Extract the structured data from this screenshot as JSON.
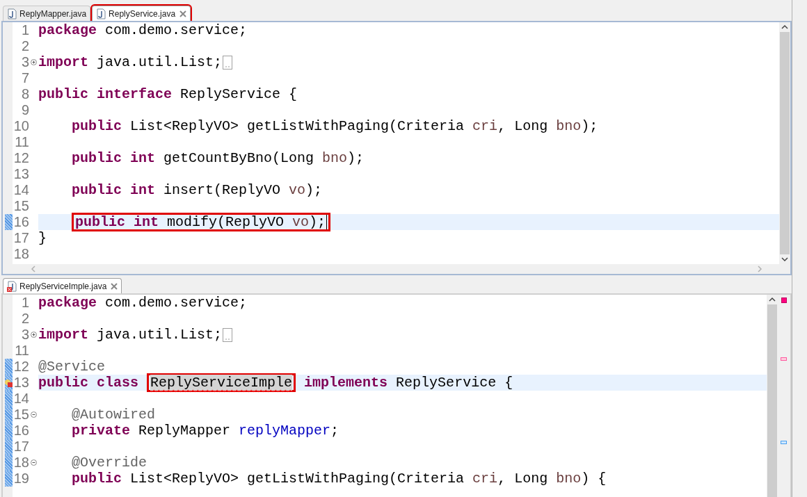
{
  "editors": [
    {
      "active": true,
      "tabs": [
        {
          "label": "ReplyMapper.java",
          "selected": false,
          "boxed": false,
          "error": false,
          "closable": false
        },
        {
          "label": "ReplyService.java",
          "selected": true,
          "boxed": true,
          "error": false,
          "closable": true
        }
      ],
      "lines": [
        {
          "number": "1",
          "segments": [
            {
              "kind": "kw",
              "text": "package"
            },
            {
              "kind": "plain",
              "text": " com.demo.service;"
            }
          ]
        },
        {
          "number": "2"
        },
        {
          "number": "3",
          "fold": {
            "collapsed": true
          },
          "folded": true,
          "segments": [
            {
              "kind": "kw",
              "text": "import"
            },
            {
              "kind": "plain",
              "text": " java.util.List;"
            }
          ]
        },
        {
          "number": "7"
        },
        {
          "number": "8",
          "segments": [
            {
              "kind": "kw",
              "text": "public"
            },
            {
              "kind": "kw",
              "text": " interface"
            },
            {
              "kind": "plain",
              "text": " ReplyService {"
            }
          ]
        },
        {
          "number": "9"
        },
        {
          "number": "10",
          "indented": true,
          "segments": [
            {
              "kind": "kw",
              "text": "public"
            },
            {
              "kind": "plain",
              "text": " List<ReplyVO> getListWithPaging(Criteria"
            },
            {
              "kind": "param",
              "text": " cri"
            },
            {
              "kind": "plain",
              "text": ", Long"
            },
            {
              "kind": "param",
              "text": " bno"
            },
            {
              "kind": "plain",
              "text": ");"
            }
          ]
        },
        {
          "number": "11"
        },
        {
          "number": "12",
          "indented": true,
          "segments": [
            {
              "kind": "kw",
              "text": "public"
            },
            {
              "kind": "kw",
              "text": " int"
            },
            {
              "kind": "plain",
              "text": " getCountByBno(Long"
            },
            {
              "kind": "param",
              "text": " bno"
            },
            {
              "kind": "plain",
              "text": ");"
            }
          ]
        },
        {
          "number": "13"
        },
        {
          "number": "14",
          "indented": true,
          "segments": [
            {
              "kind": "kw",
              "text": "public"
            },
            {
              "kind": "kw",
              "text": " int"
            },
            {
              "kind": "plain",
              "text": " insert(ReplyVO"
            },
            {
              "kind": "param",
              "text": " vo"
            },
            {
              "kind": "plain",
              "text": ");"
            }
          ]
        },
        {
          "number": "15"
        },
        {
          "number": "16",
          "indented": true,
          "current": true,
          "changed": true,
          "caret": true,
          "boxed": true,
          "segments": [
            {
              "kind": "kw",
              "text": "public"
            },
            {
              "kind": "kw",
              "text": " int"
            },
            {
              "kind": "plain",
              "text": " modify(ReplyVO"
            },
            {
              "kind": "param",
              "text": " vo"
            },
            {
              "kind": "plain",
              "text": ");"
            }
          ]
        },
        {
          "number": "17",
          "segments": [
            {
              "kind": "plain",
              "text": "}"
            }
          ]
        },
        {
          "number": "18"
        }
      ]
    },
    {
      "active": false,
      "tabs": [
        {
          "label": "ReplyServiceImple.java",
          "selected": true,
          "boxed": false,
          "error": true,
          "closable": true
        }
      ],
      "lines": [
        {
          "number": "1",
          "segments": [
            {
              "kind": "kw",
              "text": "package"
            },
            {
              "kind": "plain",
              "text": " com.demo.service;"
            }
          ]
        },
        {
          "number": "2"
        },
        {
          "number": "3",
          "fold": {
            "collapsed": true
          },
          "folded": true,
          "segments": [
            {
              "kind": "kw",
              "text": "import"
            },
            {
              "kind": "plain",
              "text": " java.util.List;"
            }
          ]
        },
        {
          "number": "11"
        },
        {
          "number": "12",
          "changed": true,
          "segments": [
            {
              "kind": "annotation",
              "text": "@Service"
            }
          ]
        },
        {
          "number": "13",
          "changed": true,
          "current": true,
          "problem": true,
          "segments": [
            {
              "kind": "kw",
              "text": "public"
            },
            {
              "kind": "kw",
              "text": " class "
            },
            {
              "kind": "plain",
              "text": "ReplyServiceImple",
              "boxed": true,
              "error": true,
              "occurrence": true
            },
            {
              "kind": "kw",
              "text": " implements"
            },
            {
              "kind": "plain",
              "text": " ReplyService {"
            }
          ]
        },
        {
          "number": "14",
          "changed": true
        },
        {
          "number": "15",
          "changed": true,
          "indented": true,
          "fold": {
            "collapsed": false
          },
          "segments": [
            {
              "kind": "annotation",
              "text": "@Autowired"
            }
          ]
        },
        {
          "number": "16",
          "changed": true,
          "indented": true,
          "segments": [
            {
              "kind": "kw",
              "text": "private"
            },
            {
              "kind": "plain",
              "text": " ReplyMapper"
            },
            {
              "kind": "field",
              "text": " replyMapper"
            },
            {
              "kind": "plain",
              "text": ";"
            }
          ]
        },
        {
          "number": "17",
          "changed": true
        },
        {
          "number": "18",
          "changed": true,
          "indented": true,
          "fold": {
            "collapsed": false
          },
          "segments": [
            {
              "kind": "annotation",
              "text": "@Override"
            }
          ]
        },
        {
          "number": "19",
          "changed": true,
          "indented": true,
          "segments": [
            {
              "kind": "kw",
              "text": "public"
            },
            {
              "kind": "plain",
              "text": " List<ReplyVO> getListWithPaging(Criteria"
            },
            {
              "kind": "param",
              "text": " cri"
            },
            {
              "kind": "plain",
              "text": ", Long"
            },
            {
              "kind": "param",
              "text": " bno"
            },
            {
              "kind": "plain",
              "text": ") {"
            }
          ]
        }
      ]
    }
  ]
}
